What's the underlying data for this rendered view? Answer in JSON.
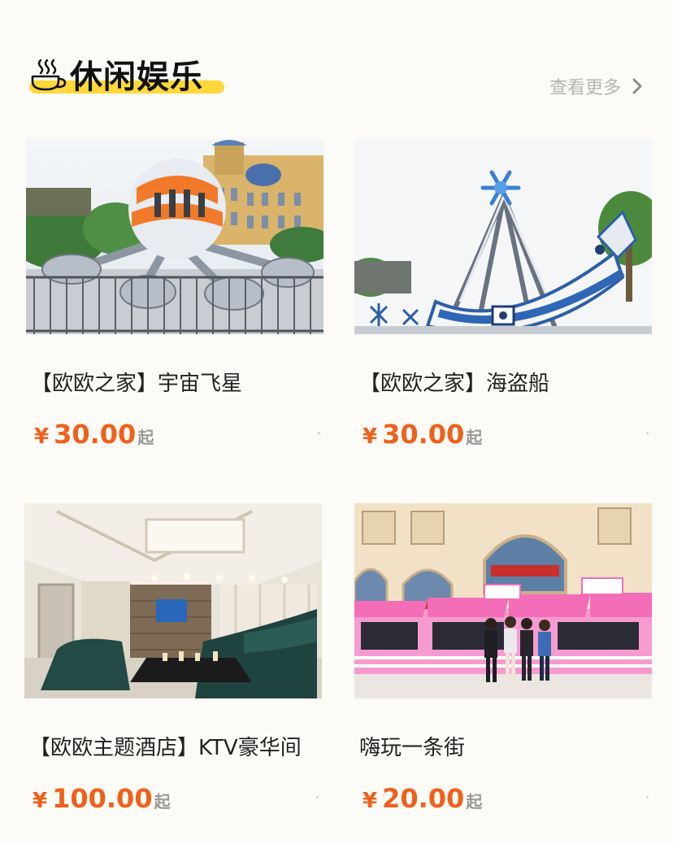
{
  "section": {
    "title": "休闲娱乐",
    "more_label": "查看更多",
    "icon": "coffee-cup-icon",
    "accent_color": "#ffd83a"
  },
  "items": [
    {
      "name": "【欧欧之家】宇宙飞星",
      "currency": "¥",
      "price": "30.00",
      "price_suffix": "起",
      "image": "octopus-ride-photo"
    },
    {
      "name": "【欧欧之家】海盗船",
      "currency": "¥",
      "price": "30.00",
      "price_suffix": "起",
      "image": "pirate-ship-ride-photo"
    },
    {
      "name": "【欧欧主题酒店】KTV豪华间",
      "currency": "¥",
      "price": "100.00",
      "price_suffix": "起",
      "image": "ktv-room-photo"
    },
    {
      "name": "嗨玩一条街",
      "currency": "¥",
      "price": "20.00",
      "price_suffix": "起",
      "image": "carnival-street-photo"
    }
  ],
  "colors": {
    "price": "#f0601a",
    "background": "#fcfbf7"
  }
}
